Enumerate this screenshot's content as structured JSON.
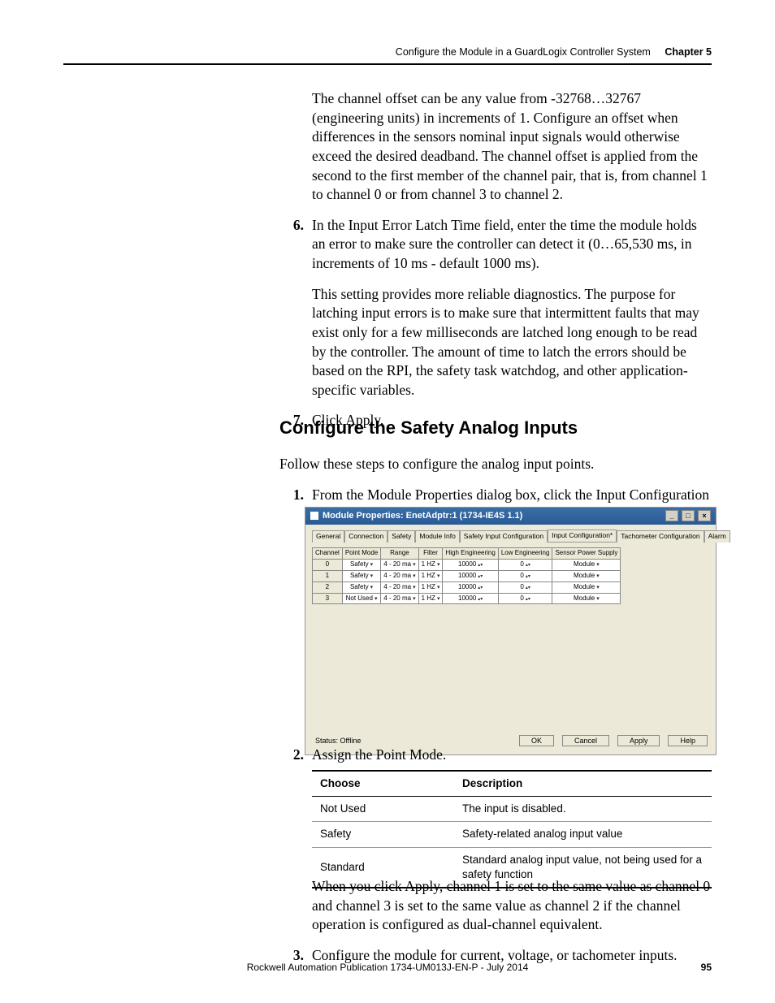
{
  "header": {
    "running_title": "Configure the Module in a GuardLogix Controller System",
    "chapter_label": "Chapter 5"
  },
  "body": {
    "para_offset": "The channel offset can be any value from -32768…32767 (engineering units) in increments of 1. Configure an offset when differences in the sensors nominal input signals would otherwise exceed the desired deadband. The channel offset is applied from the second to the first member of the channel pair, that is, from channel 1 to channel 0 or from channel 3 to channel 2.",
    "step6_num": "6.",
    "step6_text": "In the Input Error Latch Time field, enter the time the module holds an error to make sure the controller can detect it (0…65,530 ms, in increments of 10 ms - default 1000 ms).",
    "step6_para2": "This setting provides more reliable diagnostics. The purpose for latching input errors is to make sure that intermittent faults that may exist only for a few milliseconds are latched long enough to be read by the controller. The amount of time to latch the errors should be based on the RPI, the safety task watchdog, and other application-specific variables.",
    "step7_num": "7.",
    "step7_text": "Click Apply.",
    "section_title": "Configure the Safety Analog Inputs",
    "section_intro": "Follow these steps to configure the analog input points.",
    "step1_num": "1.",
    "step1_text": "From the Module Properties dialog box, click the Input Configuration tab.",
    "step2_num": "2.",
    "step2_text": "Assign the Point Mode.",
    "after_table": "When you click Apply, channel 1 is set to the same value as channel 0 and channel 3 is set to the same value as channel 2 if the channel operation is configured as dual-channel equivalent.",
    "step3_num": "3.",
    "step3_text": "Configure the module for current, voltage, or tachometer inputs."
  },
  "dialog": {
    "title": "Module Properties: EnetAdptr:1 (1734-IE4S 1.1)",
    "tabs": [
      "General",
      "Connection",
      "Safety",
      "Module Info",
      "Safety Input Configuration",
      "Input Configuration*",
      "Tachometer Configuration",
      "Alarm"
    ],
    "active_tab_index": 5,
    "headers": [
      "Channel",
      "Point Mode",
      "Range",
      "Filter",
      "High Engineering",
      "Low Engineering",
      "Sensor Power Supply"
    ],
    "rows": [
      {
        "ch": "0",
        "mode": "Safety",
        "range": "4 - 20 ma",
        "filter": "1 HZ",
        "hi": "10000",
        "lo": "0",
        "sps": "Module"
      },
      {
        "ch": "1",
        "mode": "Safety",
        "range": "4 - 20 ma",
        "filter": "1 HZ",
        "hi": "10000",
        "lo": "0",
        "sps": "Module"
      },
      {
        "ch": "2",
        "mode": "Safety",
        "range": "4 - 20 ma",
        "filter": "1 HZ",
        "hi": "10000",
        "lo": "0",
        "sps": "Module"
      },
      {
        "ch": "3",
        "mode": "Not Used",
        "range": "4 - 20 ma",
        "filter": "1 HZ",
        "hi": "10000",
        "lo": "0",
        "sps": "Module"
      }
    ],
    "status_label": "Status: Offline",
    "buttons": {
      "ok": "OK",
      "cancel": "Cancel",
      "apply": "Apply",
      "help": "Help"
    },
    "win_controls": {
      "min": "_",
      "max": "□",
      "close": "×"
    }
  },
  "pm_table": {
    "head": [
      "Choose",
      "Description"
    ],
    "rows": [
      [
        "Not Used",
        "The input is disabled."
      ],
      [
        "Safety",
        "Safety-related analog input value"
      ],
      [
        "Standard",
        "Standard analog input value, not being used for a safety function"
      ]
    ]
  },
  "footer": {
    "pub": "Rockwell Automation Publication 1734-UM013J-EN-P - July 2014",
    "page": "95"
  }
}
